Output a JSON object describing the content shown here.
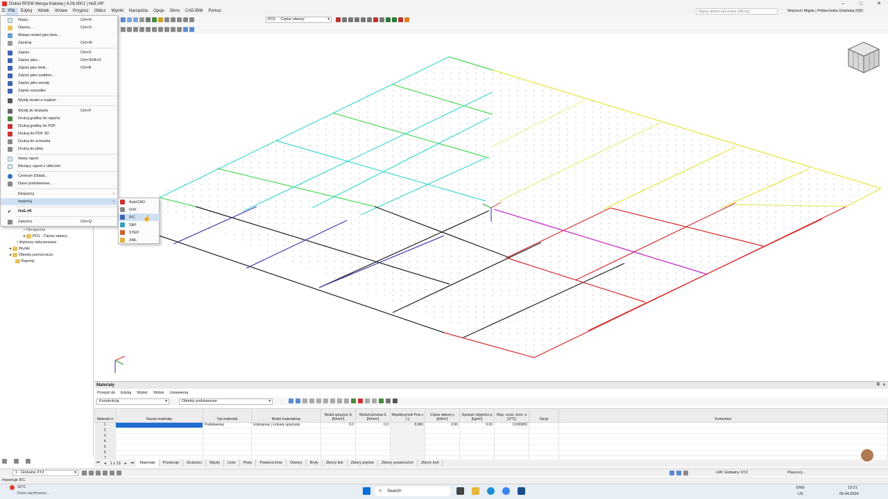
{
  "window": {
    "title": "Dlubal RFEM Wersja trialowa | 6.06.0001 | HoE.rf6*",
    "controls": [
      "–",
      "□",
      "✕"
    ]
  },
  "menubar": [
    "Plik",
    "Edytuj",
    "Widok",
    "Wstaw",
    "Przypisz",
    "Oblicz",
    "Wyniki",
    "Narzędzia",
    "Opcje",
    "Okno",
    "CAD-BIM",
    "Pomoc"
  ],
  "keyword_search": {
    "placeholder": "Wpisz słowo kluczowe (Alt+Q)"
  },
  "user": "Wojciech Migda | Politechnika Gdańska (KB)",
  "toolbar": {
    "load_case_id": "PO1",
    "load_case_name": "Ciężar własny"
  },
  "file_menu": {
    "items": [
      {
        "label": "Nowy...",
        "shortcut": "Ctrl+N",
        "icon": "new-file-icon"
      },
      {
        "label": "Otwórz...",
        "shortcut": "Ctrl+O",
        "icon": "open-folder-icon"
      },
      {
        "label": "Wstaw model jako blok...",
        "shortcut": "",
        "icon": "insert-block-icon"
      },
      {
        "label": "Zamknij",
        "shortcut": "Ctrl+W",
        "icon": "close-file-icon"
      },
      {
        "label": "Zapisz",
        "shortcut": "Ctrl+S",
        "icon": "save-icon"
      },
      {
        "label": "Zapisz jako...",
        "shortcut": "Ctrl+Shift+S",
        "icon": "save-as-icon"
      },
      {
        "label": "Zapisz jako blok...",
        "shortcut": "Ctrl+B",
        "icon": "save-block-icon"
      },
      {
        "label": "Zapisz jako szablon...",
        "shortcut": "",
        "icon": "save-template-icon"
      },
      {
        "label": "Zapisz jako wersję",
        "shortcut": "",
        "icon": "save-version-icon"
      },
      {
        "label": "Zapisz wszystko",
        "shortcut": "",
        "icon": "save-all-icon"
      },
      {
        "label": "Wyślij model e-mailem",
        "shortcut": "",
        "icon": "email-icon"
      },
      {
        "label": "Wyślij do drukarki",
        "shortcut": "Ctrl+P",
        "icon": "printer-icon"
      },
      {
        "label": "Drukuj grafikę do raportu",
        "shortcut": "",
        "icon": "print-graphic-report-icon"
      },
      {
        "label": "Drukuj grafikę do PDF",
        "shortcut": "",
        "icon": "pdf-icon"
      },
      {
        "label": "Drukuj do PDF 3D",
        "shortcut": "",
        "icon": "pdf-3d-icon"
      },
      {
        "label": "Drukuj do schowka",
        "shortcut": "",
        "icon": "clipboard-icon"
      },
      {
        "label": "Drukuj do pliku",
        "shortcut": "",
        "icon": "print-file-icon"
      },
      {
        "label": "Nowy raport",
        "shortcut": "",
        "icon": "new-report-icon"
      },
      {
        "label": "Bieżący raport z obliczeń",
        "shortcut": "",
        "icon": "report-icon"
      },
      {
        "label": "Centrum Dlubal...",
        "shortcut": "",
        "icon": "dlubal-center-icon"
      },
      {
        "label": "Dane podstawowe...",
        "shortcut": "",
        "icon": "base-data-icon"
      },
      {
        "label": "Eksportuj",
        "shortcut": "",
        "icon": ""
      },
      {
        "label": "Importuj",
        "shortcut": "",
        "icon": ""
      },
      {
        "label": "HoE.rf6",
        "shortcut": "",
        "icon": "checkmark-icon"
      },
      {
        "label": "Zakończ",
        "shortcut": "Ctrl+Q",
        "icon": "exit-icon"
      }
    ]
  },
  "import_submenu": [
    {
      "label": "AutoCAD",
      "icon": "autocad-icon"
    },
    {
      "label": "DXF",
      "icon": "dxf-icon"
    },
    {
      "label": "IFC",
      "icon": "ifc-icon"
    },
    {
      "label": "SAF",
      "icon": "saf-icon"
    },
    {
      "label": "STEP",
      "icon": "step-icon"
    },
    {
      "label": "XML",
      "icon": "xml-icon"
    }
  ],
  "navigator": [
    "Obciążenia",
    "PO1 - Ciężar własny",
    "Wykresy obliczeniowe",
    "Wyniki",
    "Obiekty pomocnicze",
    "Raporty"
  ],
  "materials_panel": {
    "title": "Materiały",
    "menu": [
      "Przejdź do",
      "Edytuj",
      "Wybór",
      "Widok",
      "Ustawienia"
    ],
    "filter": "Konstrukcja",
    "objects": "Obiekty podstawowe",
    "columns": [
      "Materiał nr",
      "Nazwa materiału",
      "Typ materiału",
      "Model materiałowy",
      "Moduł sprężyst. E [N/mm²]",
      "Moduł ścinania G [N/mm²]",
      "Współczynnik Pois v [-]",
      "Ciężar własny γ [kN/m³]",
      "Gęstość objętości ρ [kg/m³]",
      "Wsp. rozsz. term. α [1/°C]",
      "Opcje",
      "Komentarz"
    ],
    "rows": [
      [
        "1",
        "",
        "Podstawowy",
        "Izotropowy | Liniowy sprężysty",
        "0.0",
        "0.0",
        "0.000",
        "0.00",
        "0.00",
        "0.000000",
        "",
        ""
      ],
      [
        "2",
        "",
        "",
        "",
        "",
        "",
        "",
        "",
        "",
        "",
        "",
        ""
      ],
      [
        "3",
        "",
        "",
        "",
        "",
        "",
        "",
        "",
        "",
        "",
        "",
        ""
      ],
      [
        "4",
        "",
        "",
        "",
        "",
        "",
        "",
        "",
        "",
        "",
        "",
        ""
      ],
      [
        "5",
        "",
        "",
        "",
        "",
        "",
        "",
        "",
        "",
        "",
        "",
        ""
      ],
      [
        "6",
        "",
        "",
        "",
        "",
        "",
        "",
        "",
        "",
        "",
        "",
        ""
      ],
      [
        "7",
        "",
        "",
        "",
        "",
        "",
        "",
        "",
        "",
        "",
        "",
        ""
      ]
    ],
    "pager": "1 z 13",
    "tabs": [
      "Materiały",
      "Przekroje",
      "Grubości",
      "Węzły",
      "Linie",
      "Pręty",
      "Powierzchnie",
      "Otwory",
      "Bryły",
      "Zbiory linii",
      "Zbiory prętów",
      "Zbiory powierzchni",
      "Zbiory brył"
    ]
  },
  "statusbar": {
    "cs": "1 - Globalny XYZ",
    "message": "Importuje IFC.",
    "cs_right": "UW: Globalny XYZ",
    "plane": "Płaszczy..."
  },
  "taskbar": {
    "weather_temp": "15°C",
    "weather_text": "Duże zachmurze...",
    "search": "Search",
    "lang": "ENG",
    "layout": "US",
    "time": "13:21",
    "date": "05.04.2024"
  }
}
